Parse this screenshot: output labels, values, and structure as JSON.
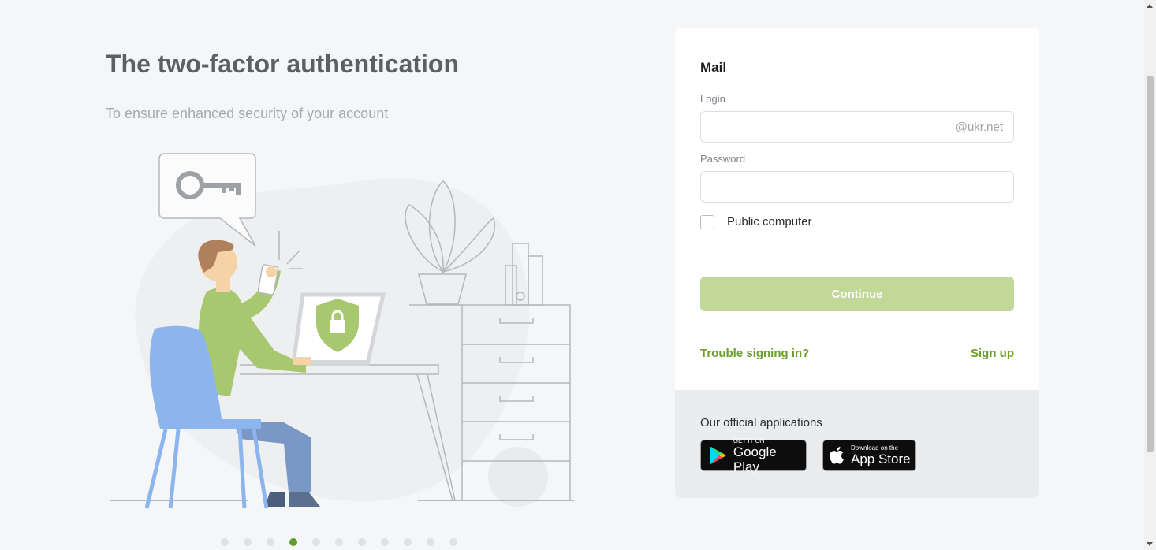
{
  "hero": {
    "title": "The two-factor authentication",
    "subtitle": "To ensure enhanced security of your account"
  },
  "carousel": {
    "total_slides": 11,
    "active_index": 3
  },
  "login_card": {
    "title": "Mail",
    "login_label": "Login",
    "login_value": "",
    "login_suffix": "@ukr.net",
    "password_label": "Password",
    "password_value": "",
    "public_computer_label": "Public computer",
    "public_computer_checked": false,
    "continue_label": "Continue",
    "trouble_link": "Trouble signing in?",
    "signup_link": "Sign up"
  },
  "apps": {
    "title": "Our official applications",
    "google_play": {
      "small": "GET IT ON",
      "big": "Google Play"
    },
    "app_store": {
      "small": "Download on the",
      "big": "App Store"
    }
  },
  "colors": {
    "accent": "#6ca02a",
    "button_disabled": "#c2d899",
    "illustration_green": "#a8c86f",
    "chair_blue": "#8cb5ee",
    "pants_blue": "#7a98c6"
  }
}
